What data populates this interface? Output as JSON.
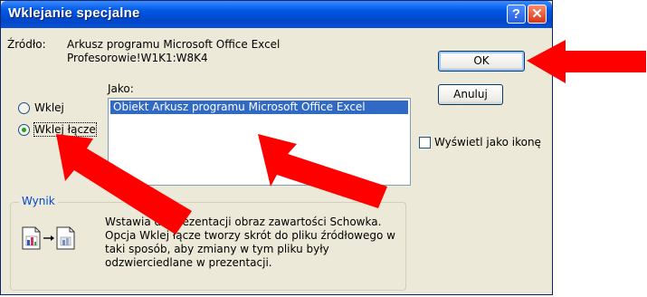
{
  "dialog": {
    "title": "Wklejanie specjalne",
    "help_button": "?",
    "close_button": "✕"
  },
  "source": {
    "label": "Źródło:",
    "line1": "Arkusz programu Microsoft Office Excel",
    "line2": "Profesorowie!W1K1:W8K4"
  },
  "buttons": {
    "ok": "OK",
    "cancel": "Anuluj"
  },
  "as": {
    "label": "Jako:",
    "items": [
      "Obiekt Arkusz programu Microsoft Office Excel"
    ],
    "selected": 0
  },
  "paste_options": {
    "paste": "Wklej",
    "paste_link": "Wklej łącze",
    "selected": "paste_link"
  },
  "display_as_icon": {
    "label": "Wyświetl jako ikonę",
    "checked": false
  },
  "result": {
    "label": "Wynik",
    "line1": "Wstawia do prezentacji obraz zawartości Schowka.",
    "line2": "Opcja Wklej łącze tworzy skrót do pliku źródłowego w",
    "line3": "taki sposób, aby zmiany w tym pliku były",
    "line4": "odzwierciedlane w prezentacji."
  },
  "colors": {
    "arrow": "#ff0000",
    "title_bar": "#0058e6",
    "dialog_bg": "#ece9d8",
    "selection": "#316ac5"
  }
}
